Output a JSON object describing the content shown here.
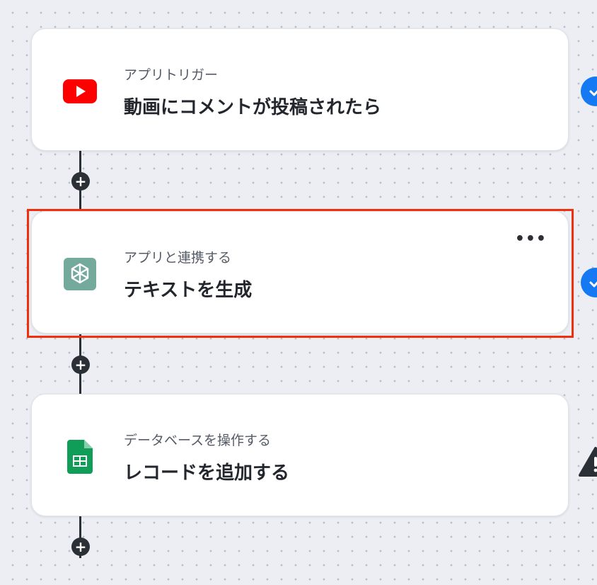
{
  "steps": [
    {
      "subtitle": "アプリトリガー",
      "title": "動画にコメントが投稿されたら",
      "app_icon": "youtube-icon",
      "status": "check-icon"
    },
    {
      "subtitle": "アプリと連携する",
      "title": "テキストを生成",
      "app_icon": "chatgpt-icon",
      "status": "check-icon",
      "menu_label": "•••",
      "selected": true
    },
    {
      "subtitle": "データベースを操作する",
      "title": "レコードを追加する",
      "app_icon": "google-sheets-icon",
      "status": "warning-icon"
    }
  ],
  "add_button_label": "+",
  "colors": {
    "youtube": "#ff0000",
    "chatgpt": "#74aa9c",
    "sheets": "#0f9d58",
    "check": "#1479f2",
    "highlight": "#f22f0d",
    "connector": "#2b2f36"
  }
}
